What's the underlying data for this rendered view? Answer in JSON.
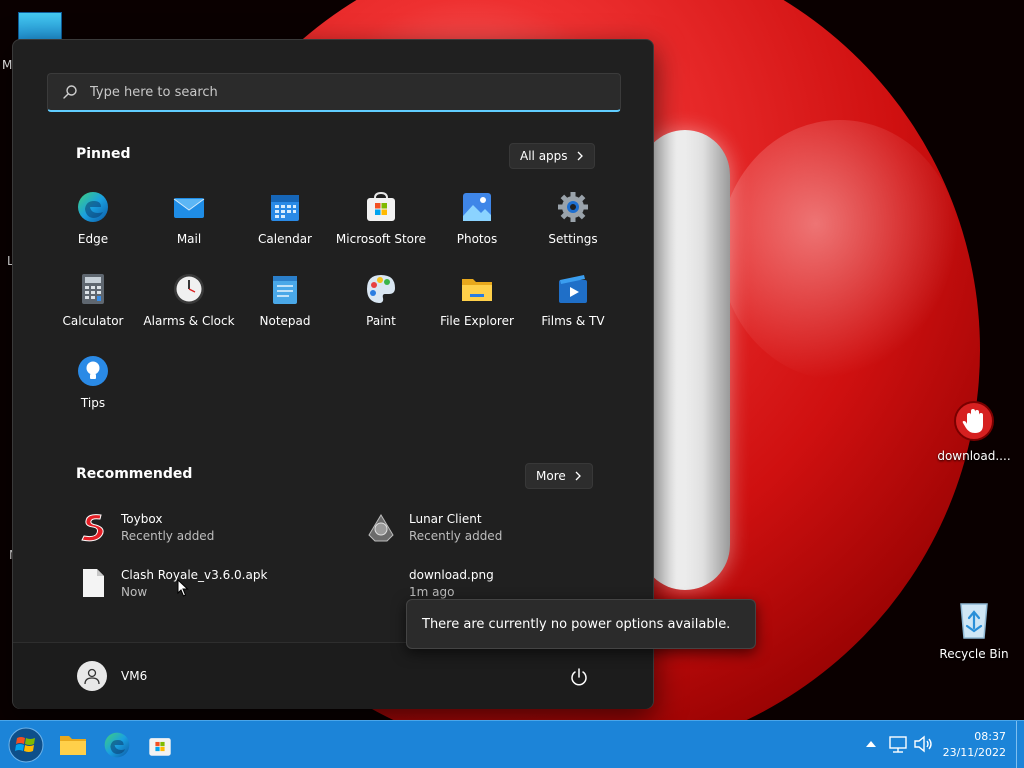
{
  "search": {
    "placeholder": "Type here to search"
  },
  "pinned": {
    "title": "Pinned",
    "all_apps_label": "All apps",
    "apps": [
      {
        "label": "Edge",
        "icon": "edge-icon"
      },
      {
        "label": "Mail",
        "icon": "mail-icon"
      },
      {
        "label": "Calendar",
        "icon": "calendar-icon"
      },
      {
        "label": "Microsoft Store",
        "icon": "store-icon"
      },
      {
        "label": "Photos",
        "icon": "photos-icon"
      },
      {
        "label": "Settings",
        "icon": "gear-icon"
      },
      {
        "label": "Calculator",
        "icon": "calculator-icon"
      },
      {
        "label": "Alarms & Clock",
        "icon": "clock-icon"
      },
      {
        "label": "Notepad",
        "icon": "notepad-icon"
      },
      {
        "label": "Paint",
        "icon": "palette-icon"
      },
      {
        "label": "File Explorer",
        "icon": "folder-icon"
      },
      {
        "label": "Films & TV",
        "icon": "film-icon"
      },
      {
        "label": "Tips",
        "icon": "lightbulb-icon"
      }
    ]
  },
  "recommended": {
    "title": "Recommended",
    "more_label": "More",
    "items": [
      {
        "name": "Toybox",
        "sub": "Recently added",
        "icon": "toybox-icon"
      },
      {
        "name": "Lunar Client",
        "sub": "Recently added",
        "icon": "lunar-client-icon"
      },
      {
        "name": "Clash Royale_v3.6.0.apk",
        "sub": "Now",
        "icon": "file-icon"
      },
      {
        "name": "download.png",
        "sub": "1m ago",
        "icon": "image-file-icon"
      }
    ]
  },
  "user": {
    "name": "VM6"
  },
  "tooltip": {
    "text": "There are currently no power options available."
  },
  "desktop": {
    "icons": [
      {
        "label": "download....",
        "icon": "stop-hand-icon"
      },
      {
        "label": "Recycle Bin",
        "icon": "recycle-bin-icon"
      }
    ],
    "edge_letters": [
      "M",
      "L",
      "N"
    ]
  },
  "taskbar": {
    "time": "08:37",
    "date": "23/11/2022",
    "color": "#1c84d8"
  },
  "colors": {
    "accent": "#60cdff",
    "menu_bg": "#202020"
  }
}
